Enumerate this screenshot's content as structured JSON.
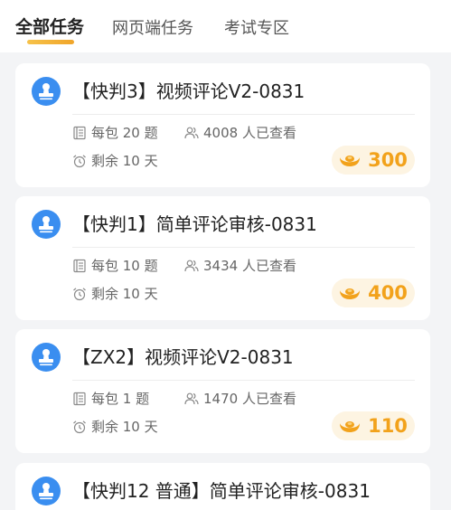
{
  "tabs": [
    {
      "label": "全部任务",
      "active": true
    },
    {
      "label": "网页端任务",
      "active": false
    },
    {
      "label": "考试专区",
      "active": false
    }
  ],
  "icons": {
    "task": "stamp-icon",
    "package": "package-icon",
    "viewers": "users-icon",
    "time": "alarm-clock-icon",
    "reward": "gold-ingot-icon"
  },
  "colors": {
    "accent": "#f0a52a",
    "icon_blue": "#3a8ef0",
    "reward_text": "#f2a21b",
    "reward_bg": "#fdf4e2"
  },
  "tasks": [
    {
      "title": "【快判3】视频评论V2-0831",
      "per_pack": "每包 20 题",
      "viewers": "4008 人已查看",
      "remaining": "剩余 10 天",
      "reward": "300"
    },
    {
      "title": "【快判1】简单评论审核-0831",
      "per_pack": "每包 10 题",
      "viewers": "3434 人已查看",
      "remaining": "剩余 10 天",
      "reward": "400"
    },
    {
      "title": "【ZX2】视频评论V2-0831",
      "per_pack": "每包 1 题",
      "viewers": "1470 人已查看",
      "remaining": "剩余 10 天",
      "reward": "110"
    },
    {
      "title": "【快判12 普通】简单评论审核-0831"
    }
  ]
}
